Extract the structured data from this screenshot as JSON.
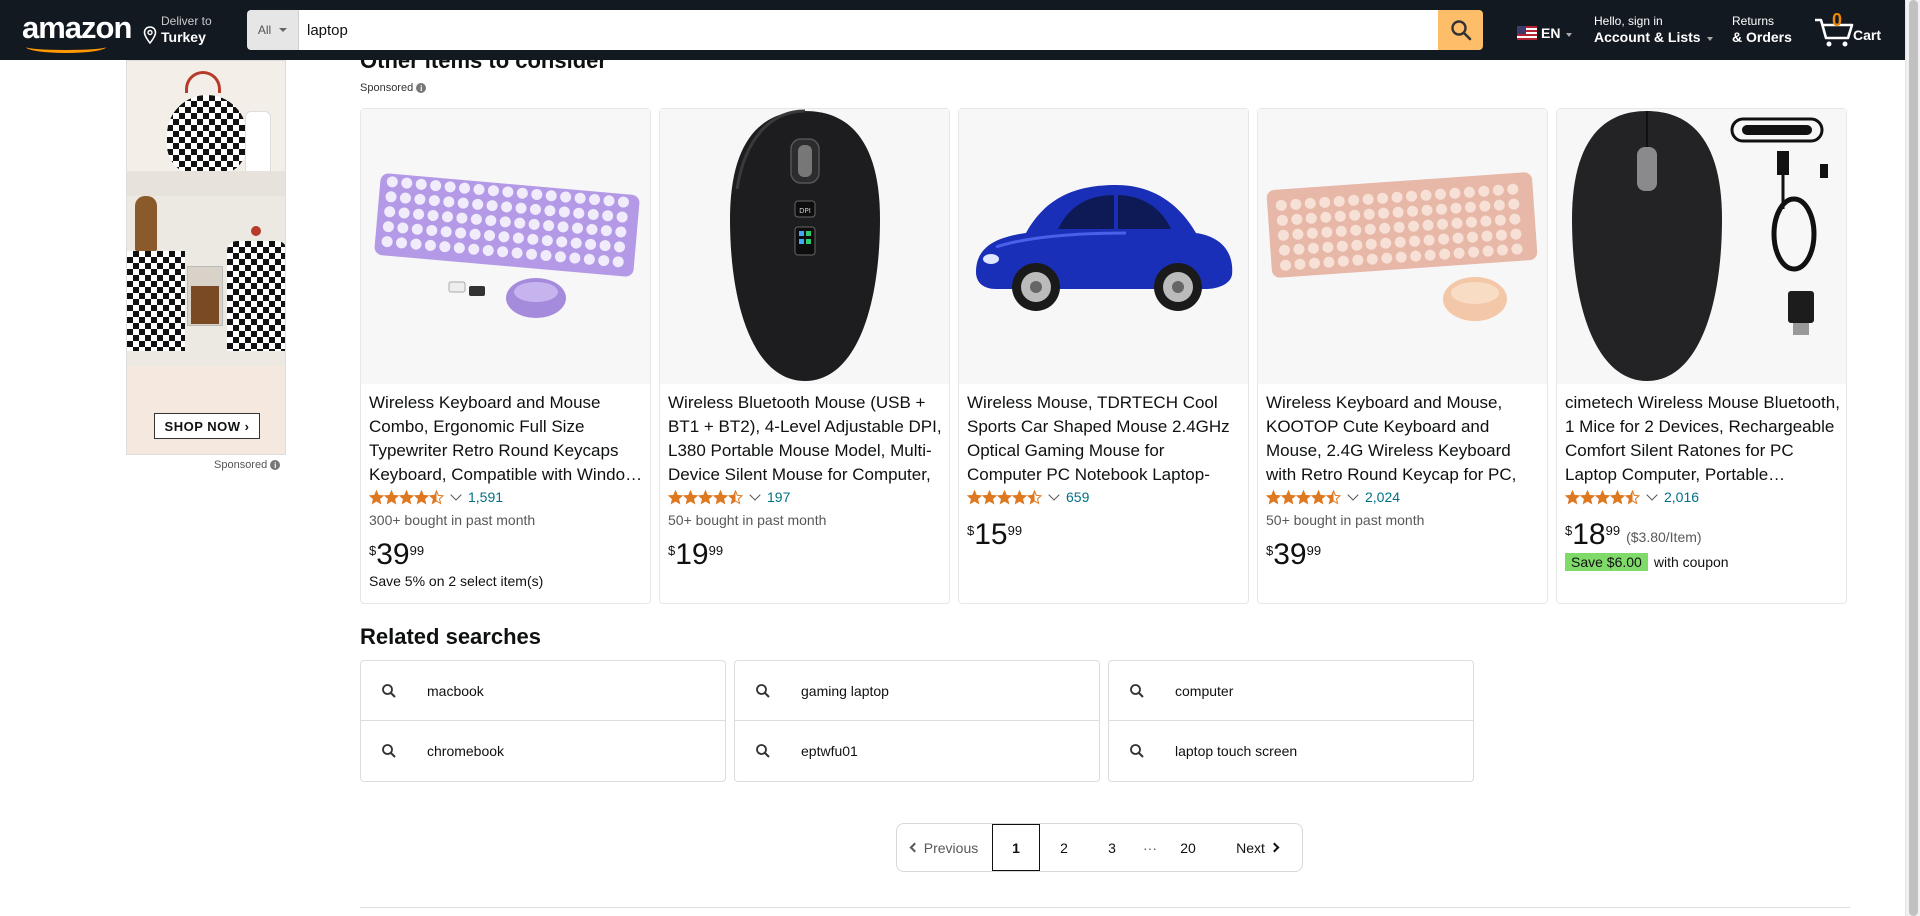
{
  "header": {
    "logo": "amazon",
    "deliver_small": "Deliver to",
    "deliver_big": "Turkey",
    "search_category": "All",
    "search_value": "laptop",
    "lang": "EN",
    "account_small": "Hello, sign in",
    "account_big": "Account & Lists",
    "returns_small": "Returns",
    "returns_big": "& Orders",
    "cart_count": "0",
    "cart_label": "Cart"
  },
  "ad": {
    "cta": "SHOP NOW ›",
    "sponsored": "Sponsored"
  },
  "section": {
    "title": "Other items to consider",
    "sponsored": "Sponsored"
  },
  "products": [
    {
      "title": "Wireless Keyboard and Mouse Combo, Ergonomic Full Size Typewriter Retro Round Keycaps Keyboard, Compatible with Windo…",
      "rating": 4.5,
      "reviews": "1,591",
      "bought": "300+ bought in past month",
      "price_symbol": "$",
      "price_whole": "39",
      "price_fraction": "99",
      "note": "Save 5% on 2 select item(s)",
      "image": "purple-keyboard-mouse"
    },
    {
      "title": "Wireless Bluetooth Mouse (USB + BT1 + BT2), 4-Level Adjustable DPI, L380 Portable Mouse Model, Multi-Device Silent Mouse for Computer, Laptop, iPad,…",
      "rating": 4.5,
      "reviews": "197",
      "bought": "50+ bought in past month",
      "price_symbol": "$",
      "price_whole": "19",
      "price_fraction": "99",
      "image": "black-mouse"
    },
    {
      "title": "Wireless Mouse, TDRTECH Cool Sports Car Shaped Mouse 2.4GHz Optical Gaming Mouse for Computer PC Notebook Laptop-Blue",
      "rating": 4.5,
      "reviews": "659",
      "price_symbol": "$",
      "price_whole": "15",
      "price_fraction": "99",
      "image": "blue-car-mouse"
    },
    {
      "title": "Wireless Keyboard and Mouse, KOOTOP Cute Keyboard and Mouse, 2.4G Wireless Keyboard with Retro Round Keycap for PC, Mac,…",
      "rating": 4.5,
      "reviews": "2,024",
      "bought": "50+ bought in past month",
      "price_symbol": "$",
      "price_whole": "39",
      "price_fraction": "99",
      "image": "pink-keyboard-mouse"
    },
    {
      "title": "cimetech Wireless Mouse Bluetooth, 1 Mice for 2 Devices, Rechargeable Comfort Silent Ratones for PC Laptop Computer, Portable…",
      "rating": 4.5,
      "reviews": "2,016",
      "price_symbol": "$",
      "price_whole": "18",
      "price_fraction": "99",
      "unit_price": "($3.80/Item)",
      "coupon_badge": "Save $6.00",
      "coupon_text": "with coupon",
      "image": "black-mouse-cable"
    }
  ],
  "related": {
    "title": "Related searches",
    "items": [
      "macbook",
      "gaming laptop",
      "computer",
      "chromebook",
      "eptwfu01",
      "laptop touch screen"
    ]
  },
  "pagination": {
    "previous": "Previous",
    "pages": [
      "1",
      "2",
      "3"
    ],
    "dots": "···",
    "last": "20",
    "next": "Next",
    "current": "1"
  },
  "colors": {
    "header_bg": "#131921",
    "accent": "#febd69",
    "link": "#007185",
    "star": "#de7921",
    "coupon": "#7fda69"
  }
}
